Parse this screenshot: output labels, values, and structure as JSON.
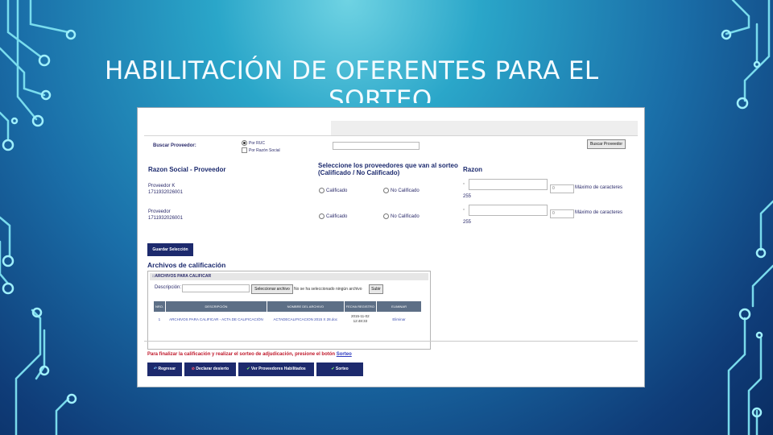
{
  "slide": {
    "title_line1": "HABILITACIÓN DE OFERENTES PARA EL",
    "title_line2": "SORTEO"
  },
  "colors": {
    "header_navy": "#1d2a6d",
    "alert_red": "#c0182b",
    "link_blue": "#2d3ac0"
  },
  "search": {
    "label": "Buscar Proveedor:",
    "options": [
      "Por RUC",
      "Por Razón Social"
    ],
    "selected": "Por RUC",
    "button": "Buscar Proveedor"
  },
  "columns": {
    "provider": "Razon Social - Proveedor",
    "select_line1": "Seleccione los proveedores que van al sorteo",
    "select_line2": "(Calificado / No Calificado)",
    "reason": "Razon"
  },
  "providers": [
    {
      "name": "Proveedor K",
      "ruc": "1711932026001",
      "opt_yes": "Calificado",
      "opt_no": "No Calificado",
      "count": "0",
      "max_label": "Máximo de caracteres",
      "remaining": "255"
    },
    {
      "name": "Proveedor",
      "ruc": "1711932026001",
      "opt_yes": "Calificado",
      "opt_no": "No Calificado",
      "count": "0",
      "max_label": "Máximo de caracteres",
      "remaining": "255"
    }
  ],
  "save_button": "Guardar Selección",
  "files": {
    "section_title": "Archivos de calificación",
    "panel_title": "::ARCHIVOS PARA CALIFICAR",
    "desc_label": "Descripción:",
    "choose_button": "Seleccionar archivo",
    "no_file": "No se ha seleccionado ningún archivo",
    "upload_button": "Subir",
    "headers": [
      "NRO.",
      "DESCRIPCIÓN",
      "NOMBRE DEL ARCHIVO",
      "FECHA REGISTRO",
      "ELIMINAR"
    ],
    "rows": [
      {
        "nro": "1",
        "description": "ARCHIVOS PARA CALIFICAR - ACTA DE CALIFICACIÓN",
        "filename": "ACTADECALIFICACION 2015 X 28.doc",
        "date": "2015-11-02",
        "time": "12:48:33",
        "delete": "Eliminar"
      }
    ]
  },
  "footer": {
    "note": "Para finalizar la calificación y realizar el sorteo de adjudicación, presione el botón",
    "note_link": "Sorteo",
    "buttons": {
      "back": "Regresar",
      "deserted": "Declarar desierto",
      "enabled": "Ver Proveedores Habilitados",
      "draw": "Sorteo"
    }
  }
}
